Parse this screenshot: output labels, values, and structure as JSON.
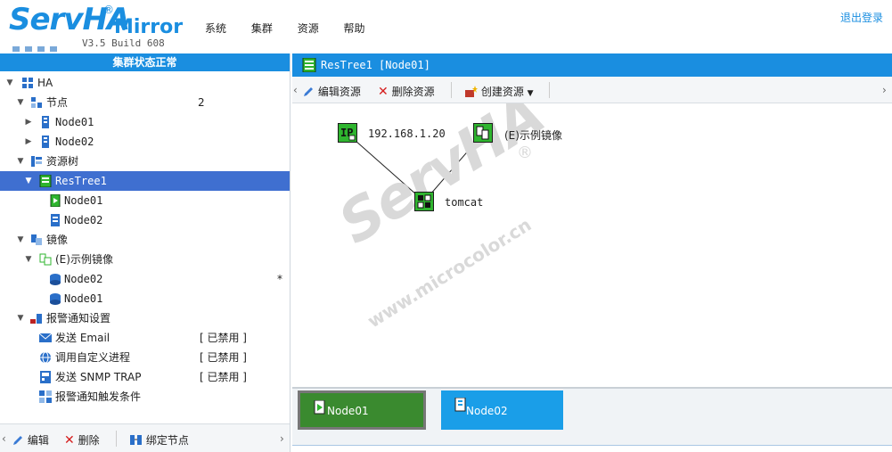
{
  "header": {
    "logo_brand": "ServHA",
    "logo_reg": "®",
    "logo_mirror": "Mirror",
    "version": "V3.5 Build 608",
    "menu": [
      "系统",
      "集群",
      "资源",
      "帮助"
    ],
    "logout": "退出登录"
  },
  "left": {
    "status": "集群状态正常",
    "tree": [
      {
        "label": "HA",
        "value": ""
      },
      {
        "label": "节点",
        "value": "2"
      },
      {
        "label": "Node01",
        "value": ""
      },
      {
        "label": "Node02",
        "value": ""
      },
      {
        "label": "资源树",
        "value": ""
      },
      {
        "label": "ResTree1",
        "value": ""
      },
      {
        "label": "Node01",
        "value": ""
      },
      {
        "label": "Node02",
        "value": ""
      },
      {
        "label": "镜像",
        "value": ""
      },
      {
        "label": "(E)示例镜像",
        "value": ""
      },
      {
        "label": "Node02",
        "value": "*"
      },
      {
        "label": "Node01",
        "value": ""
      },
      {
        "label": "报警通知设置",
        "value": ""
      },
      {
        "label": "发送 Email",
        "value": "[ 已禁用 ]"
      },
      {
        "label": "调用自定义进程",
        "value": "[ 已禁用 ]"
      },
      {
        "label": "发送 SNMP TRAP",
        "value": "[ 已禁用 ]"
      },
      {
        "label": "报警通知触发条件",
        "value": ""
      }
    ],
    "toolbar": {
      "edit": "编辑",
      "delete": "删除",
      "bind": "绑定节点"
    }
  },
  "right": {
    "title": "ResTree1 [Node01]",
    "toolbar": {
      "edit": "编辑资源",
      "delete": "删除资源",
      "create": "创建资源"
    },
    "graph": {
      "ip_label": "192.168.1.20",
      "mirror_label": "(E)示例镜像",
      "app_label": "tomcat"
    },
    "watermark": {
      "brand": "ServHA",
      "reg": "®",
      "site": "www.microcolor.cn"
    },
    "node_tabs": [
      {
        "label": "Node01",
        "color": "#3a8a2f"
      },
      {
        "label": "Node02",
        "color": "#1a9ee8"
      }
    ]
  },
  "colors": {
    "accent": "#1a8ee0",
    "selected": "#3f6fd0",
    "node_green": "#2fb52f"
  }
}
